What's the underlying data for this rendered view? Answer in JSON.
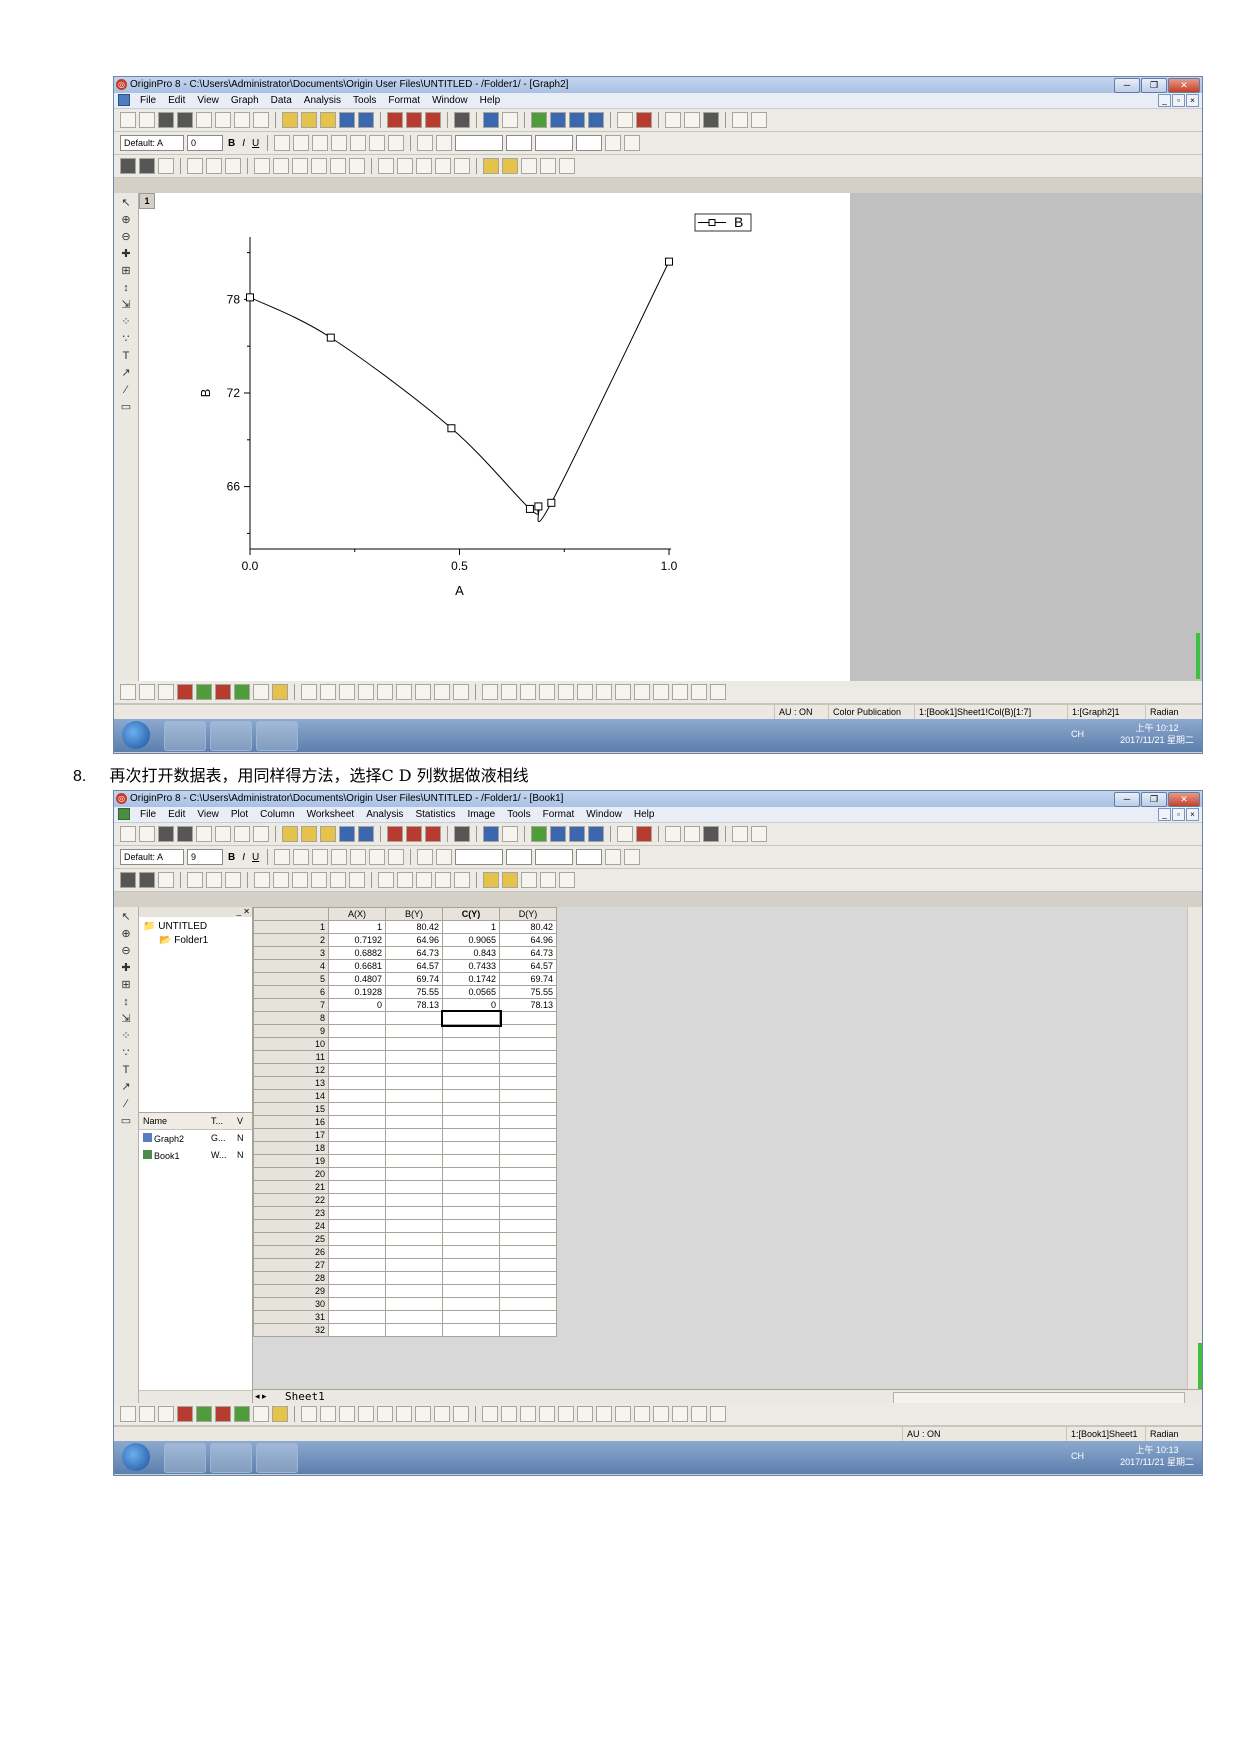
{
  "window1": {
    "title": "OriginPro 8 - C:\\Users\\Administrator\\Documents\\Origin User Files\\UNTITLED - /Folder1/ - [Graph2]",
    "menus": [
      "File",
      "Edit",
      "View",
      "Graph",
      "Data",
      "Analysis",
      "Tools",
      "Format",
      "Window",
      "Help"
    ],
    "format_toolbar": {
      "font_label": "Default: A",
      "font_size": "0",
      "bold": "B",
      "italic": "I",
      "underline": "U"
    },
    "layer_number": "1",
    "legend_label": "B",
    "status": [
      "AU : ON",
      "Color Publication",
      "1:[Book1]Sheet1!Col(B)[1:7]",
      "1:[Graph2]1",
      "Radian"
    ],
    "clock_time": "上午 10:12",
    "clock_date": "2017/11/21 星期二"
  },
  "chart_data": {
    "type": "line",
    "title": "",
    "xlabel": "A",
    "ylabel": "B",
    "xlim": [
      0.0,
      1.0
    ],
    "ylim": [
      62,
      82
    ],
    "xticks": [
      "0.0",
      "0.5",
      "1.0"
    ],
    "yticks": [
      "66",
      "72",
      "78"
    ],
    "series": [
      {
        "name": "B",
        "x": [
          0,
          0.1928,
          0.4807,
          0.6681,
          0.6882,
          0.7192,
          1
        ],
        "y": [
          78.13,
          75.55,
          69.74,
          64.57,
          64.73,
          64.96,
          80.42
        ]
      }
    ],
    "legend": "top-right",
    "grid": false
  },
  "caption": {
    "number": "8.",
    "text": "再次打开数据表，用同样得方法，选择C D 列数据做液相线"
  },
  "window2": {
    "title": "OriginPro 8 - C:\\Users\\Administrator\\Documents\\Origin User Files\\UNTITLED - /Folder1/ - [Book1]",
    "menus": [
      "File",
      "Edit",
      "View",
      "Plot",
      "Column",
      "Worksheet",
      "Analysis",
      "Statistics",
      "Image",
      "Tools",
      "Format",
      "Window",
      "Help"
    ],
    "format_toolbar": {
      "font_label": "Default: A",
      "font_size": "9",
      "bold": "B",
      "italic": "I",
      "underline": "U"
    },
    "explorer": {
      "tree": [
        "UNTITLED",
        "Folder1"
      ],
      "columns": [
        "Name",
        "T...",
        "V"
      ],
      "items": [
        {
          "name": "Graph2",
          "type": "G...",
          "v": "N"
        },
        {
          "name": "Book1",
          "type": "W...",
          "v": "N"
        }
      ]
    },
    "worksheet": {
      "columns": [
        "A(X)",
        "B(Y)",
        "C(Y)",
        "D(Y)"
      ],
      "rows": [
        [
          "1",
          "80.42",
          "1",
          "80.42"
        ],
        [
          "0.7192",
          "64.96",
          "0.9065",
          "64.96"
        ],
        [
          "0.6882",
          "64.73",
          "0.843",
          "64.73"
        ],
        [
          "0.6681",
          "64.57",
          "0.7433",
          "64.57"
        ],
        [
          "0.4807",
          "69.74",
          "0.1742",
          "69.74"
        ],
        [
          "0.1928",
          "75.55",
          "0.0565",
          "75.55"
        ],
        [
          "0",
          "78.13",
          "0",
          "78.13"
        ]
      ],
      "row_count": 32,
      "sheet_tab": "Sheet1"
    },
    "status": [
      "AU : ON",
      "1:[Book1]Sheet1",
      "Radian"
    ],
    "clock_time": "上午 10:13",
    "clock_date": "2017/11/21 星期二"
  },
  "taskbar": {
    "input_indicator": "CH"
  }
}
